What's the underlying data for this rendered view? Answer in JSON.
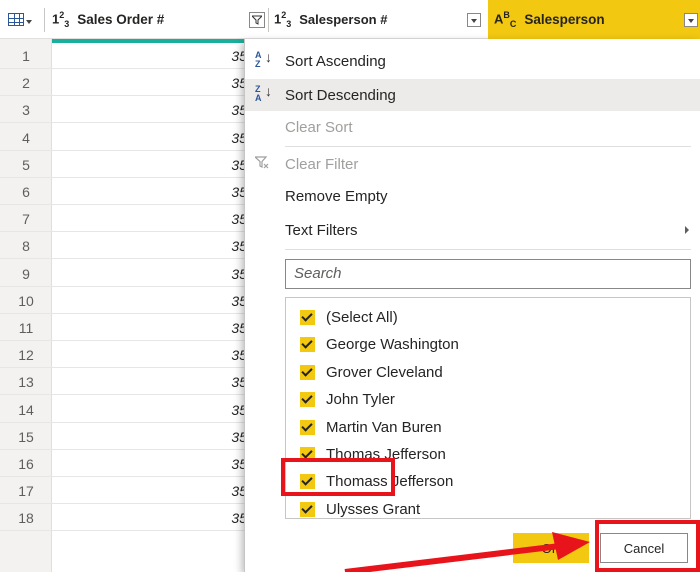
{
  "header": {
    "columns": [
      {
        "type_glyph": "1²₃",
        "title": "Sales Order #"
      },
      {
        "type_glyph": "1²₃",
        "title": "Salesperson #"
      },
      {
        "type_glyph": "AᴮC",
        "title": "Salesperson"
      }
    ],
    "col1_type": "1",
    "col1_type_sup": "2",
    "col1_type_sub": "3",
    "col2_type": "1",
    "col2_type_sup": "2",
    "col2_type_sub": "3",
    "col3_type": "A",
    "col3_type_sup": "B",
    "col3_type_sub": "C"
  },
  "rows": [
    {
      "num": "1",
      "value": "35"
    },
    {
      "num": "2",
      "value": "35"
    },
    {
      "num": "3",
      "value": "35"
    },
    {
      "num": "4",
      "value": "35"
    },
    {
      "num": "5",
      "value": "35"
    },
    {
      "num": "6",
      "value": "35"
    },
    {
      "num": "7",
      "value": "35"
    },
    {
      "num": "8",
      "value": "35"
    },
    {
      "num": "9",
      "value": "35"
    },
    {
      "num": "10",
      "value": "35"
    },
    {
      "num": "11",
      "value": "35"
    },
    {
      "num": "12",
      "value": "35"
    },
    {
      "num": "13",
      "value": "35"
    },
    {
      "num": "14",
      "value": "35"
    },
    {
      "num": "15",
      "value": "35"
    },
    {
      "num": "16",
      "value": "35"
    },
    {
      "num": "17",
      "value": "35"
    },
    {
      "num": "18",
      "value": "35"
    }
  ],
  "menu": {
    "sort_ascending": "Sort Ascending",
    "sort_descending": "Sort Descending",
    "clear_sort": "Clear Sort",
    "clear_filter": "Clear Filter",
    "remove_empty": "Remove Empty",
    "text_filters": "Text Filters",
    "search_placeholder": "Search",
    "items": [
      {
        "label": "(Select All)",
        "checked": true
      },
      {
        "label": "George Washington",
        "checked": true
      },
      {
        "label": "Grover Cleveland",
        "checked": true
      },
      {
        "label": "John Tyler",
        "checked": true
      },
      {
        "label": "Martin Van Buren",
        "checked": true
      },
      {
        "label": "Thomas Jefferson",
        "checked": true
      },
      {
        "label": "Thomass Jefferson",
        "checked": true
      },
      {
        "label": "Ulysses Grant",
        "checked": true
      }
    ],
    "ok_label": "OK",
    "cancel_label": "Cancel"
  },
  "colors": {
    "accent_yellow": "#f2c811",
    "teal_bar": "#1aaf9c",
    "annotation_red": "#e8141b"
  }
}
